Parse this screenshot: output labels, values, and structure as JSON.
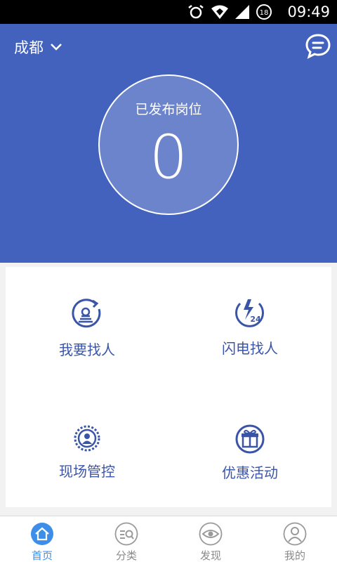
{
  "status_bar": {
    "time": "09:49",
    "battery": "18"
  },
  "header": {
    "city": "成都",
    "posted_label": "已发布岗位",
    "posted_count": "0"
  },
  "features": [
    {
      "label": "我要找人",
      "icon": "find-person-icon"
    },
    {
      "label": "闪电找人",
      "icon": "lightning-24-icon"
    },
    {
      "label": "现场管控",
      "icon": "onsite-control-icon"
    },
    {
      "label": "优惠活动",
      "icon": "gift-icon"
    }
  ],
  "tabs": [
    {
      "label": "首页",
      "icon": "home-icon",
      "active": true
    },
    {
      "label": "分类",
      "icon": "category-icon",
      "active": false
    },
    {
      "label": "发现",
      "icon": "eye-icon",
      "active": false
    },
    {
      "label": "我的",
      "icon": "user-icon",
      "active": false
    }
  ],
  "colors": {
    "primary": "#4262be",
    "feature_text": "#3a55a8",
    "active_tab": "#3c8ee8",
    "inactive_tab": "#8a8a8a"
  }
}
